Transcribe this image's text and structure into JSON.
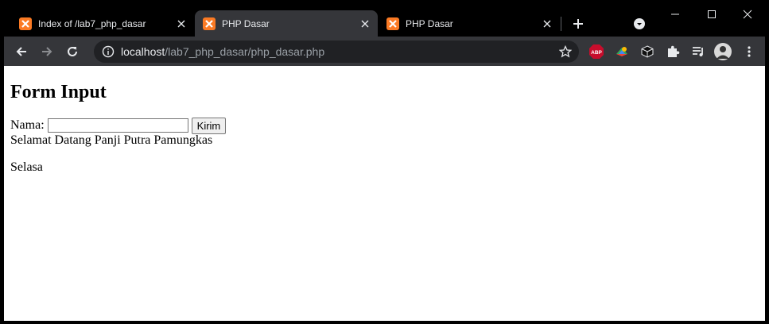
{
  "tabs": [
    {
      "title": "Index of /lab7_php_dasar",
      "active": false
    },
    {
      "title": "PHP Dasar",
      "active": true
    },
    {
      "title": "PHP Dasar",
      "active": false
    }
  ],
  "address_bar": {
    "host": "localhost",
    "path": "/lab7_php_dasar/php_dasar.php"
  },
  "extensions": {
    "adblock_label": "ABP"
  },
  "page": {
    "heading": "Form Input",
    "name_label": "Nama:",
    "name_value": "",
    "submit_label": "Kirim",
    "greeting": "Selamat Datang Panji Putra Pamungkas",
    "day": "Selasa"
  },
  "colors": {
    "tab_active": "#35363a",
    "favicon": "#fb7a24",
    "omnibox": "#202124"
  }
}
